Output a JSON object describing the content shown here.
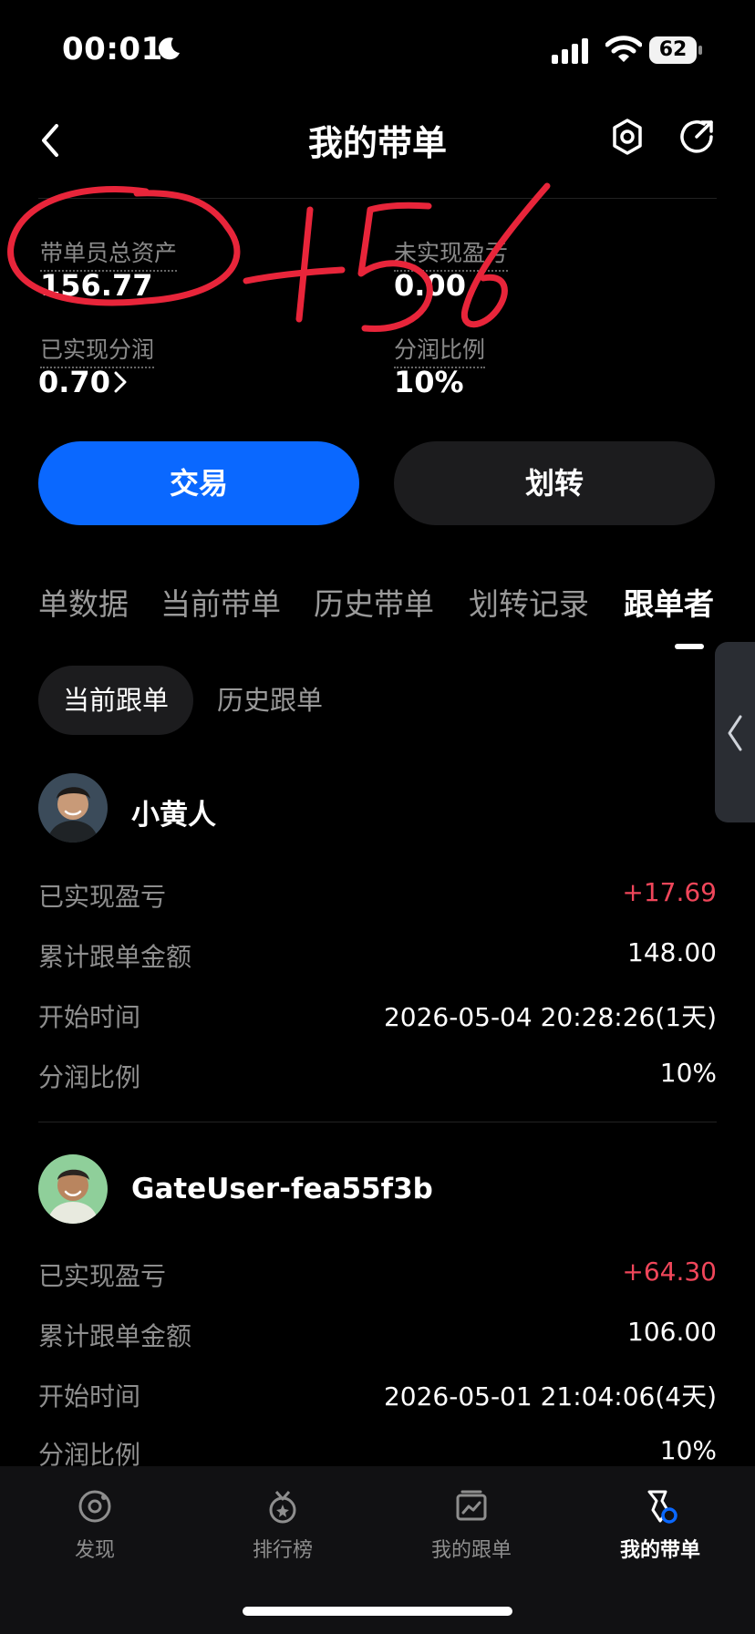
{
  "status_bar": {
    "time": "00:01",
    "battery": "62",
    "icons": [
      "moon-icon",
      "signal-icon",
      "wifi-icon",
      "battery-icon"
    ]
  },
  "header": {
    "title": "我的带单",
    "icons": [
      "back-icon",
      "settings-icon",
      "share-icon"
    ]
  },
  "stats": {
    "total_assets_label": "带单员总资产",
    "total_assets_value": "156.77",
    "unrealized_label": "未实现盈亏",
    "unrealized_value": "0.00",
    "realized_share_label": "已实现分润",
    "realized_share_value": "0.70",
    "share_ratio_label": "分润比例",
    "share_ratio_value": "10%"
  },
  "handwriting": "+56",
  "buttons": {
    "trade": "交易",
    "transfer": "划转"
  },
  "tabs": [
    {
      "label": "单数据",
      "active": false
    },
    {
      "label": "当前带单",
      "active": false
    },
    {
      "label": "历史带单",
      "active": false
    },
    {
      "label": "划转记录",
      "active": false
    },
    {
      "label": "跟单者",
      "active": true
    }
  ],
  "subtabs": {
    "current": "当前跟单",
    "history": "历史跟单"
  },
  "followers": [
    {
      "name": "小黄人",
      "rows": [
        {
          "label": "已实现盈亏",
          "value": "+17.69"
        },
        {
          "label": "累计跟单金额",
          "value": "148.00"
        },
        {
          "label": "开始时间",
          "value": "2026-05-04 20:28:26(1天)"
        },
        {
          "label": "分润比例",
          "value": "10%"
        }
      ]
    },
    {
      "name": "GateUser-fea55f3b",
      "rows": [
        {
          "label": "已实现盈亏",
          "value": "+64.30"
        },
        {
          "label": "累计跟单金额",
          "value": "106.00"
        },
        {
          "label": "开始时间",
          "value": "2026-05-01 21:04:06(4天)"
        },
        {
          "label": "分润比例",
          "value": "10%"
        }
      ]
    }
  ],
  "bottom_nav": [
    {
      "label": "发现",
      "icon": "discover-icon",
      "active": false
    },
    {
      "label": "排行榜",
      "icon": "ranking-icon",
      "active": false
    },
    {
      "label": "我的跟单",
      "icon": "my-copy-icon",
      "active": false
    },
    {
      "label": "我的带单",
      "icon": "my-lead-icon",
      "active": true
    }
  ],
  "colors": {
    "accent": "#0a68ff",
    "profit": "#f0465a",
    "background": "#000000",
    "handwriting": "#e8253a"
  }
}
